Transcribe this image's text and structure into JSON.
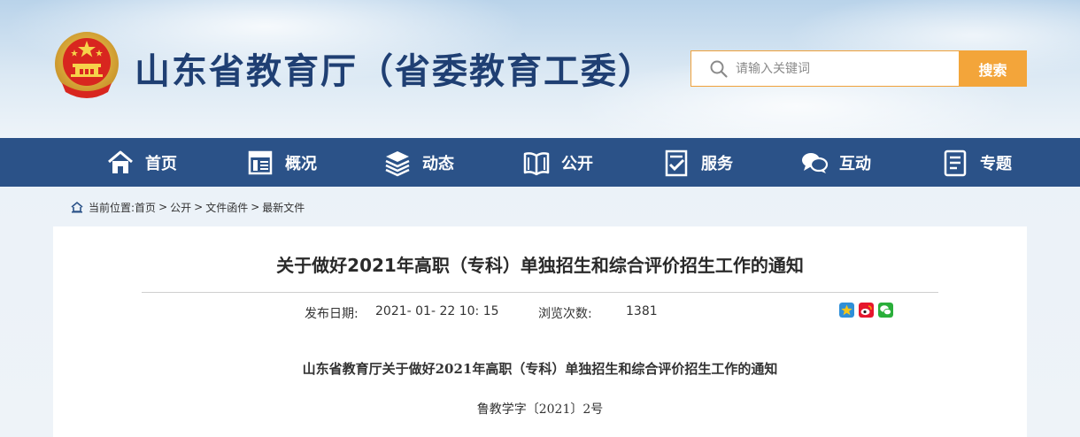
{
  "header": {
    "site_title": "山东省教育厅（省委教育工委）",
    "search": {
      "placeholder": "请输入关键词",
      "button_label": "搜索"
    }
  },
  "nav": {
    "items": [
      {
        "label": "首页",
        "icon": "home-icon"
      },
      {
        "label": "概况",
        "icon": "overview-icon"
      },
      {
        "label": "动态",
        "icon": "news-icon"
      },
      {
        "label": "公开",
        "icon": "open-book-icon"
      },
      {
        "label": "服务",
        "icon": "service-icon"
      },
      {
        "label": "互动",
        "icon": "chat-icon"
      },
      {
        "label": "专题",
        "icon": "topic-icon"
      }
    ]
  },
  "breadcrumb": {
    "prefix": "当前位置:",
    "items": [
      "首页",
      "公开",
      "文件函件",
      "最新文件"
    ],
    "separator": ">"
  },
  "article": {
    "title": "关于做好2021年高职（专科）单独招生和综合评价招生工作的通知",
    "publish_label": "发布日期:",
    "publish_date": "2021- 01- 22 10: 15",
    "views_label": "浏览次数:",
    "views": "1381",
    "share_icons": [
      "qzone-icon",
      "weibo-icon",
      "wechat-icon"
    ],
    "doc_title": "山东省教育厅关于做好2021年高职（专科）单独招生和综合评价招生工作的通知",
    "doc_number": "鲁教学字〔2021〕2号"
  },
  "colors": {
    "nav_bg": "#2b5288",
    "title_blue": "#1f3f73",
    "search_orange": "#f3a53a"
  }
}
